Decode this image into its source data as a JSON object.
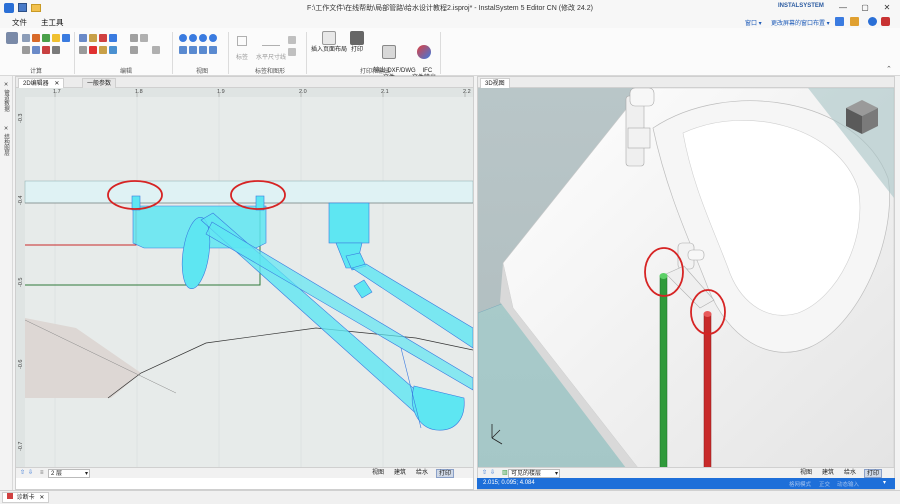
{
  "window": {
    "title": "F:\\工作文件\\在线帮助\\局部管路\\给水设计教程2.isproj* - InstalSystem 5 Editor CN (修改 24.2)",
    "minimize": "—",
    "maximize": "▢",
    "close": "✕",
    "quick_icons": [
      "app-logo-icon",
      "save-icon",
      "open-folder-icon"
    ]
  },
  "menu": {
    "tabs": [
      {
        "label": "文件",
        "active": false
      },
      {
        "label": "主工具",
        "active": true
      }
    ],
    "right": {
      "window_dropdown": "窗口 ▾",
      "layout_dropdown": "更改屏幕的窗口布置 ▾",
      "brand": "INSTALSYSTEM"
    }
  },
  "ribbon": {
    "groups": [
      {
        "label": "计算"
      },
      {
        "label": "编辑"
      },
      {
        "label": "视图"
      },
      {
        "label": "标签和图形"
      },
      {
        "label": "打印和输出"
      }
    ],
    "label_buttons": {
      "label": "标签",
      "horizontal_dim": "水平尺寸线"
    },
    "big_buttons": [
      {
        "label": "插入页面布局"
      },
      {
        "label": "打印"
      },
      {
        "label": "输出 DXF/DWG\n文件"
      },
      {
        "label": "IFC\n文件输出"
      }
    ]
  },
  "left_toolbar": {
    "items": [
      "✕ 管道数据",
      "✕ 结构图层"
    ]
  },
  "pane_2d": {
    "tabs": [
      {
        "label": "2D编辑器",
        "active": true
      },
      {
        "label": "一般参数",
        "active": false
      }
    ],
    "ruler_x": [
      "1.7",
      "1.8",
      "1.9",
      "2.0",
      "2.1",
      "2.2"
    ],
    "ruler_y": [
      "-0.3",
      "-0.4",
      "-0.5",
      "-0.6",
      "-0.7"
    ],
    "status": {
      "floor": "2 层",
      "views": [
        {
          "label": "视图",
          "active": false
        },
        {
          "label": "建筑",
          "active": false
        },
        {
          "label": "给水",
          "active": false
        },
        {
          "label": "打印",
          "active": true
        }
      ]
    }
  },
  "pane_3d": {
    "tabs": [
      {
        "label": "3D视图",
        "active": true
      }
    ],
    "status": {
      "visible_floors": "可见的楼层",
      "views": [
        {
          "label": "视图",
          "active": false
        },
        {
          "label": "建筑",
          "active": false
        },
        {
          "label": "给水",
          "active": false
        },
        {
          "label": "打印",
          "active": true
        }
      ]
    },
    "coords": "2.015; 0.095; 4.084",
    "coord_right": [
      "格网模式",
      "正交",
      "动态输入"
    ]
  },
  "bottom_tab": {
    "label": "诊断卡"
  },
  "colors": {
    "accent": "#1e6fd9",
    "fixture_cyan": "#5ee6f2",
    "pipe_green": "#2f9a3a",
    "pipe_red": "#c82a2a",
    "annotation_red": "#d62424"
  }
}
